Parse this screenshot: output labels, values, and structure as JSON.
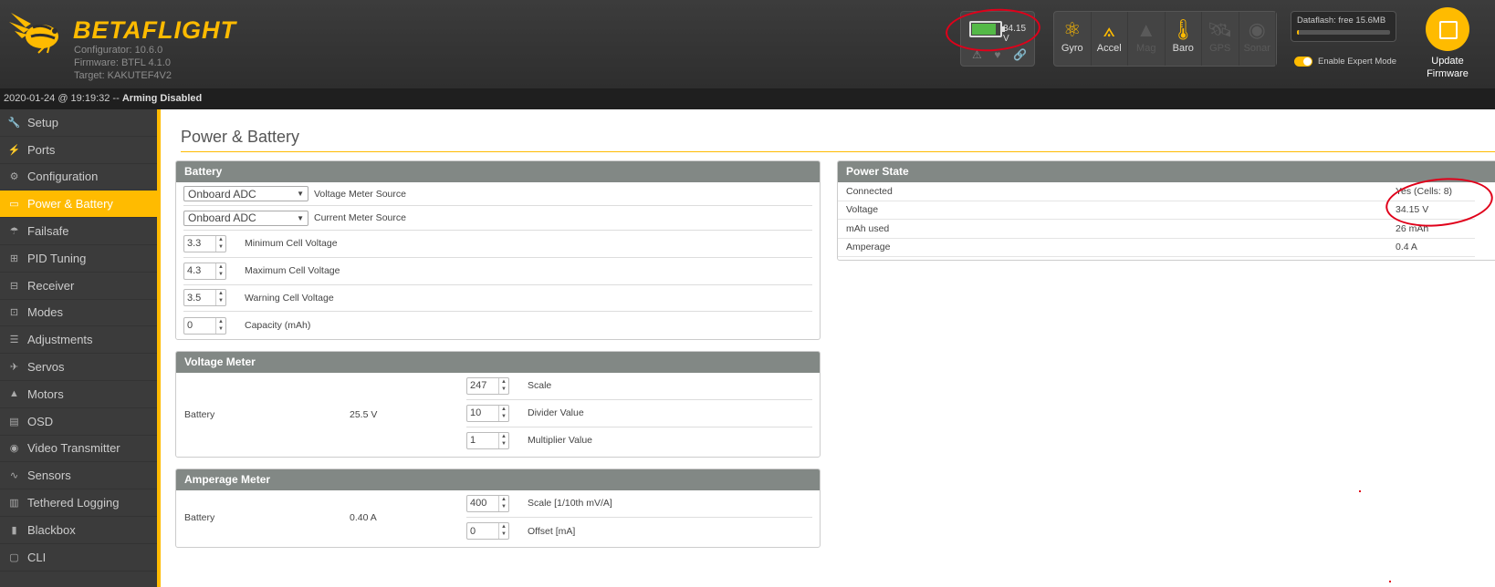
{
  "header": {
    "brand": "BETAFLIGHT",
    "configurator": "Configurator: 10.6.0",
    "firmware": "Firmware: BTFL 4.1.0",
    "target": "Target: KAKUTEF4V2",
    "battery_voltage": "34.15 V",
    "battery_fill_fraction": 0.85,
    "battery_fill_color": "#54b947",
    "accent_color": "#ffbb00",
    "sensors": [
      {
        "label": "Gyro",
        "icon": "gyro-icon",
        "glyph": "⚛",
        "active": true
      },
      {
        "label": "Accel",
        "icon": "accel-icon",
        "glyph": "⟑",
        "active": true
      },
      {
        "label": "Mag",
        "icon": "mag-icon",
        "glyph": "▲",
        "active": false
      },
      {
        "label": "Baro",
        "icon": "baro-icon",
        "glyph": "🌡",
        "active": true
      },
      {
        "label": "GPS",
        "icon": "gps-icon",
        "glyph": "🛰",
        "active": false
      },
      {
        "label": "Sonar",
        "icon": "sonar-icon",
        "glyph": "◉",
        "active": false
      }
    ],
    "dataflash": "Dataflash: free 15.6MB",
    "dataflash_used_fraction": 0.02,
    "expert_mode_label": "Enable Expert Mode",
    "expert_mode_on": true,
    "update_firmware_line1": "Update",
    "update_firmware_line2": "Firmware"
  },
  "statusbar": {
    "timestamp": "2020-01-24 @ 19:19:32 -- ",
    "arming": "Arming Disabled"
  },
  "sidebar": {
    "items": [
      {
        "label": "Setup",
        "icon": "wrench-icon",
        "glyph": "🔧"
      },
      {
        "label": "Ports",
        "icon": "plug-icon",
        "glyph": "⚡"
      },
      {
        "label": "Configuration",
        "icon": "gear-icon",
        "glyph": "⚙"
      },
      {
        "label": "Power & Battery",
        "icon": "battery-icon",
        "glyph": "▭",
        "active": true
      },
      {
        "label": "Failsafe",
        "icon": "parachute-icon",
        "glyph": "☂"
      },
      {
        "label": "PID Tuning",
        "icon": "pid-icon",
        "glyph": "⊞"
      },
      {
        "label": "Receiver",
        "icon": "receiver-icon",
        "glyph": "⊟"
      },
      {
        "label": "Modes",
        "icon": "modes-icon",
        "glyph": "⊡"
      },
      {
        "label": "Adjustments",
        "icon": "sliders-icon",
        "glyph": "☰"
      },
      {
        "label": "Servos",
        "icon": "servo-icon",
        "glyph": "✈"
      },
      {
        "label": "Motors",
        "icon": "motor-icon",
        "glyph": "▲"
      },
      {
        "label": "OSD",
        "icon": "osd-icon",
        "glyph": "▤"
      },
      {
        "label": "Video Transmitter",
        "icon": "vtx-icon",
        "glyph": "◉"
      },
      {
        "label": "Sensors",
        "icon": "sensors-icon",
        "glyph": "∿"
      },
      {
        "label": "Tethered Logging",
        "icon": "log-icon",
        "glyph": "▥"
      },
      {
        "label": "Blackbox",
        "icon": "blackbox-icon",
        "glyph": "▮"
      },
      {
        "label": "CLI",
        "icon": "cli-icon",
        "glyph": "▢"
      }
    ]
  },
  "page": {
    "title": "Power & Battery"
  },
  "battery": {
    "title": "Battery",
    "voltage_source": {
      "value": "Onboard ADC",
      "label": "Voltage Meter Source"
    },
    "current_source": {
      "value": "Onboard ADC",
      "label": "Current Meter Source"
    },
    "min_cell": {
      "value": "3.3",
      "label": "Minimum Cell Voltage"
    },
    "max_cell": {
      "value": "4.3",
      "label": "Maximum Cell Voltage"
    },
    "warn_cell": {
      "value": "3.5",
      "label": "Warning Cell Voltage"
    },
    "capacity": {
      "value": "0",
      "label": "Capacity (mAh)"
    }
  },
  "voltage_meter": {
    "title": "Voltage Meter",
    "source": "Battery",
    "reading": "25.5 V",
    "scale": {
      "value": "247",
      "label": "Scale"
    },
    "divider": {
      "value": "10",
      "label": "Divider Value"
    },
    "multiplier": {
      "value": "1",
      "label": "Multiplier Value"
    }
  },
  "amperage_meter": {
    "title": "Amperage Meter",
    "source": "Battery",
    "reading": "0.40 A",
    "scale": {
      "value": "400",
      "label": "Scale [1/10th mV/A]"
    },
    "offset": {
      "value": "0",
      "label": "Offset [mA]"
    }
  },
  "power_state": {
    "title": "Power State",
    "rows": [
      {
        "label": "Connected",
        "value": "Yes (Cells: 8)"
      },
      {
        "label": "Voltage",
        "value": "34.15 V"
      },
      {
        "label": "mAh used",
        "value": "26 mAh"
      },
      {
        "label": "Amperage",
        "value": "0.4 A"
      }
    ]
  }
}
